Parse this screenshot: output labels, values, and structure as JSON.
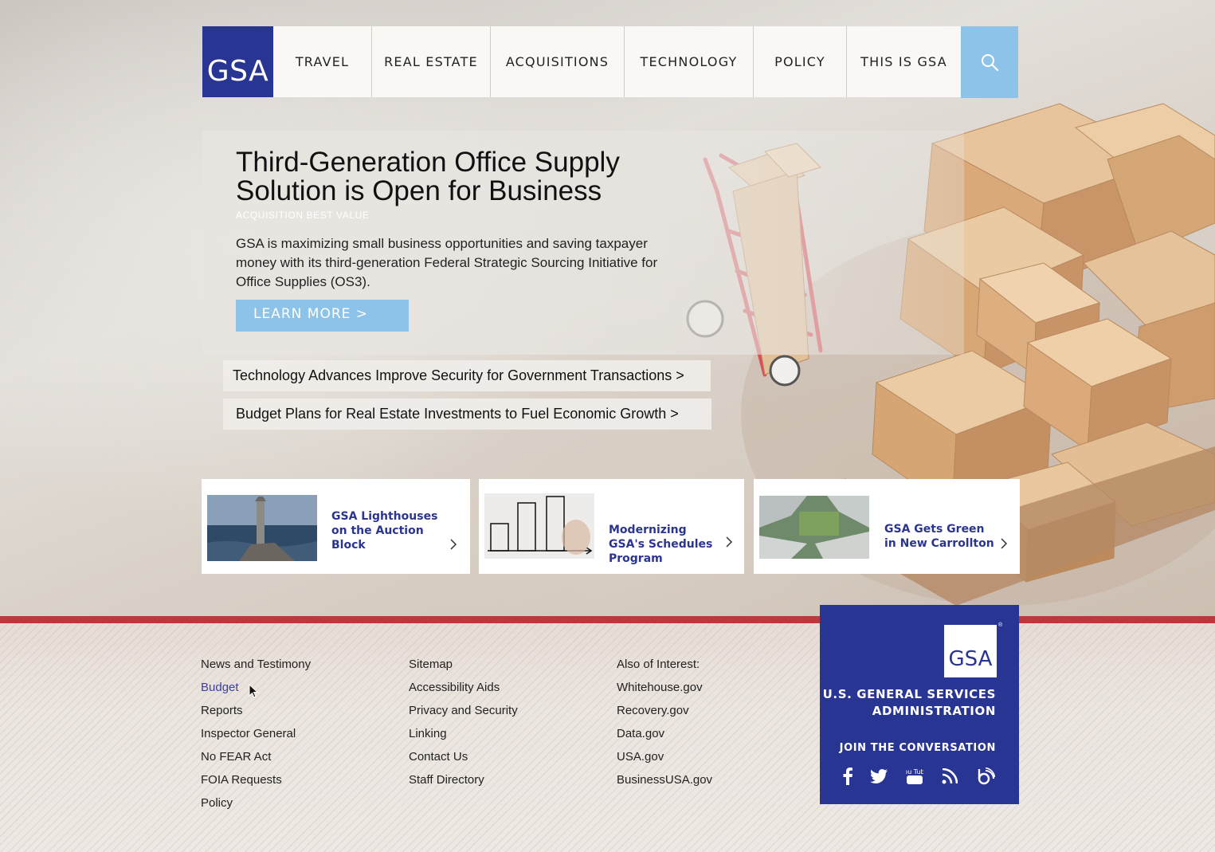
{
  "nav": {
    "logo": "GSA",
    "items": [
      {
        "label": "TRAVEL"
      },
      {
        "label": "REAL ESTATE"
      },
      {
        "label": "ACQUISITIONS"
      },
      {
        "label": "TECHNOLOGY"
      },
      {
        "label": "POLICY"
      },
      {
        "label": "THIS IS GSA"
      }
    ],
    "search_icon": "search-icon"
  },
  "hero": {
    "title": "Third-Generation Office Supply Solution is Open for Business",
    "kicker": "ACQUISITION BEST VALUE",
    "body": "GSA is maximizing small business opportunities and saving taxpayer money with its third-generation Federal Strategic Sourcing Initiative for Office Supplies (OS3).",
    "button": "LEARN MORE >"
  },
  "headlines": [
    {
      "text": "Technology Advances Improve Security for Government Transactions  >"
    },
    {
      "text": "Budget Plans for Real Estate Investments to Fuel Economic Growth  >"
    }
  ],
  "cards": [
    {
      "title": "GSA Lighthouses on the Auction Block",
      "icon": "chevron-right-icon"
    },
    {
      "title": "Modernizing GSA's Schedules Program",
      "icon": "chevron-right-icon"
    },
    {
      "title": "GSA Gets Green in New Carrollton",
      "icon": "chevron-right-icon"
    }
  ],
  "footer": {
    "col1": [
      "News and Testimony",
      "Budget",
      "Reports",
      "Inspector General",
      "No FEAR Act",
      "FOIA Requests",
      "Policy"
    ],
    "col2": [
      "Sitemap",
      "Accessibility Aids",
      "Privacy and Security",
      "Linking",
      "Contact Us",
      "Staff Directory"
    ],
    "col3": [
      "Also of Interest:",
      "Whitehouse.gov",
      "Recovery.gov",
      "Data.gov",
      "USA.gov",
      "BusinessUSA.gov"
    ],
    "active_link": "Budget",
    "link_color": "#222222",
    "active_color": "#3a3fa0"
  },
  "panel": {
    "logo": "GSA",
    "reg": "®",
    "agency_line1": "U.S. GENERAL SERVICES",
    "agency_line2": "ADMINISTRATION",
    "join": "JOIN THE CONVERSATION",
    "social_icons": [
      "facebook-icon",
      "twitter-icon",
      "youtube-icon",
      "rss-icon",
      "blog-icon"
    ],
    "youtube_label": "You Tube"
  },
  "colors": {
    "brand_blue": "#283593",
    "accent_light_blue": "#8dc3e8",
    "footer_red": "#b9393c",
    "card_title": "#2b3590"
  }
}
